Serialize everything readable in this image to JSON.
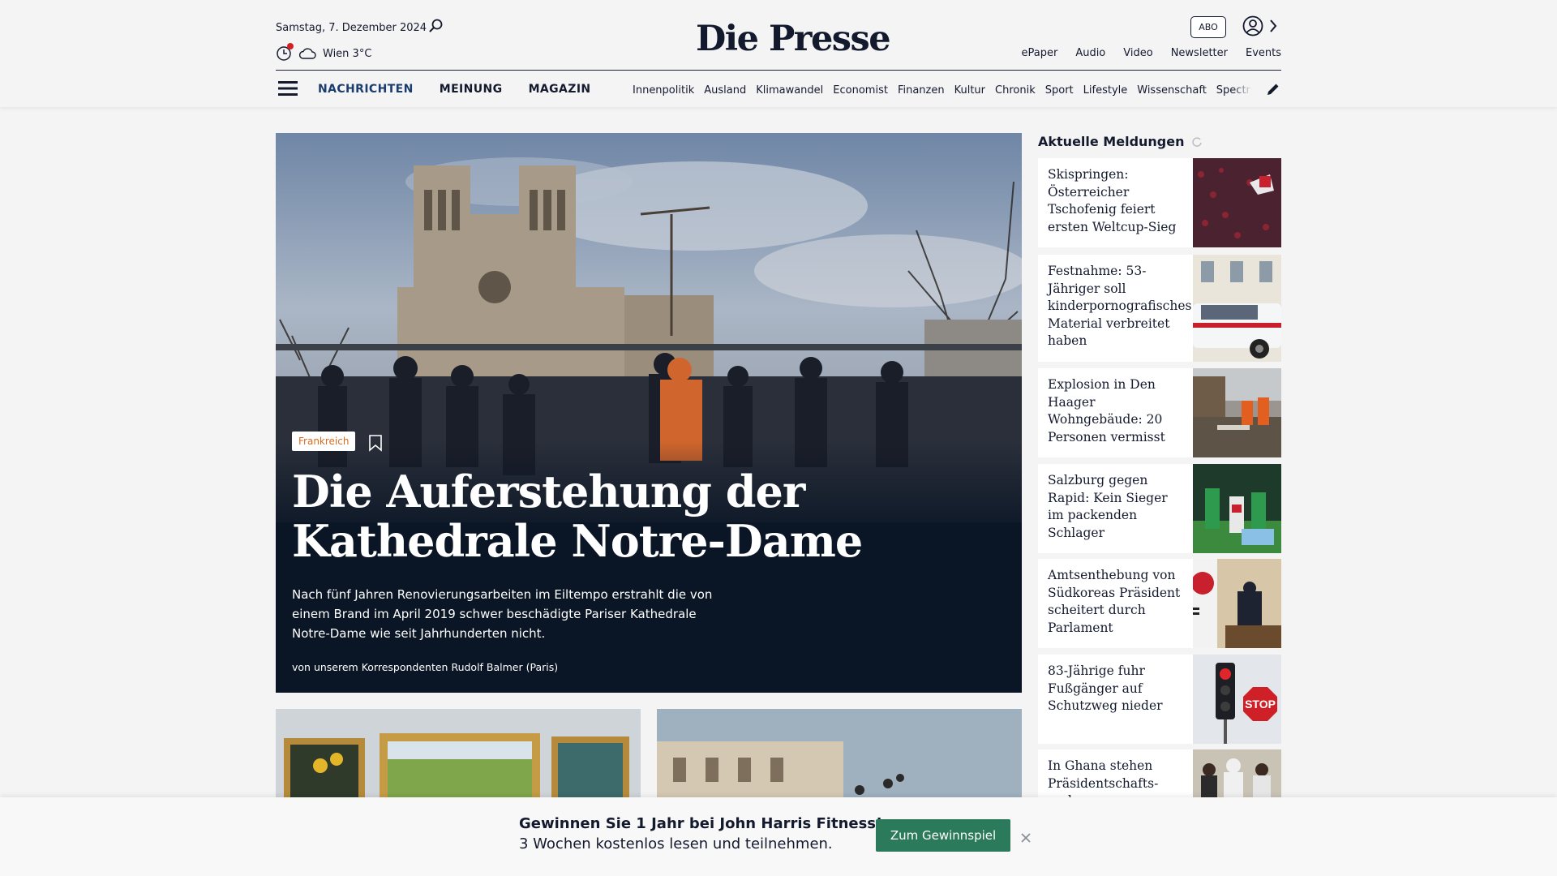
{
  "header": {
    "date": "Samstag, 7. Dezember 2024",
    "weather": "Wien 3°C",
    "logo": "Die Presse",
    "abo_label": "ABO",
    "service_nav": [
      "ePaper",
      "Audio",
      "Video",
      "Newsletter",
      "Events"
    ],
    "main_nav": [
      "NACHRICHTEN",
      "MEINUNG",
      "MAGAZIN"
    ],
    "section_nav": [
      "Innenpolitik",
      "Ausland",
      "Klimawandel",
      "Economist",
      "Finanzen",
      "Kultur",
      "Chronik",
      "Sport",
      "Lifestyle",
      "Wissenschaft",
      "Spectrum"
    ]
  },
  "hero": {
    "tag": "Frankreich",
    "title": "Die Auferstehung der Kathedrale Notre-Dame",
    "lead": "Nach fünf Jahren Renovierungsarbeiten im Eiltempo erstrahlt die von einem Brand im April 2019 schwer beschädigte Pariser Kathedrale Notre-Dame wie seit Jahrhunderten nicht.",
    "author": "von unserem Korrespondenten Rudolf Balmer (Paris)"
  },
  "sidebar": {
    "title": "Aktuelle Meldungen",
    "items": [
      {
        "title": "Skispringen: Österreicher Tschofenig feiert ersten Weltcup-Sieg"
      },
      {
        "title": "Festnahme: 53-Jähriger soll kinderpornografisches Material verbreitet haben"
      },
      {
        "title": "Explosion in Den Haager Wohngebäude: 20 Personen vermisst"
      },
      {
        "title": "Salzburg gegen Rapid: Kein Sieger im packenden Schlager"
      },
      {
        "title": "Amtsenthebung von Südkoreas Präsident scheitert durch Parlament"
      },
      {
        "title": "83-Jährige fuhr Fußgänger auf Schutzweg nieder"
      },
      {
        "title": "In Ghana stehen Präsidentschafts- und Parlamentswahlen an"
      }
    ]
  },
  "banner": {
    "headline": "Gewinnen Sie 1 Jahr bei John Harris Fitness!",
    "sub": "3 Wochen kostenlos lesen und teilnehmen.",
    "cta": "Zum Gewinnspiel"
  },
  "colors": {
    "brand_navy": "#141a2e",
    "nav_active": "#1b3c6e",
    "tag_orange": "#d86b1f",
    "cta_green": "#2b7a5b",
    "alert_red": "#d32027"
  }
}
